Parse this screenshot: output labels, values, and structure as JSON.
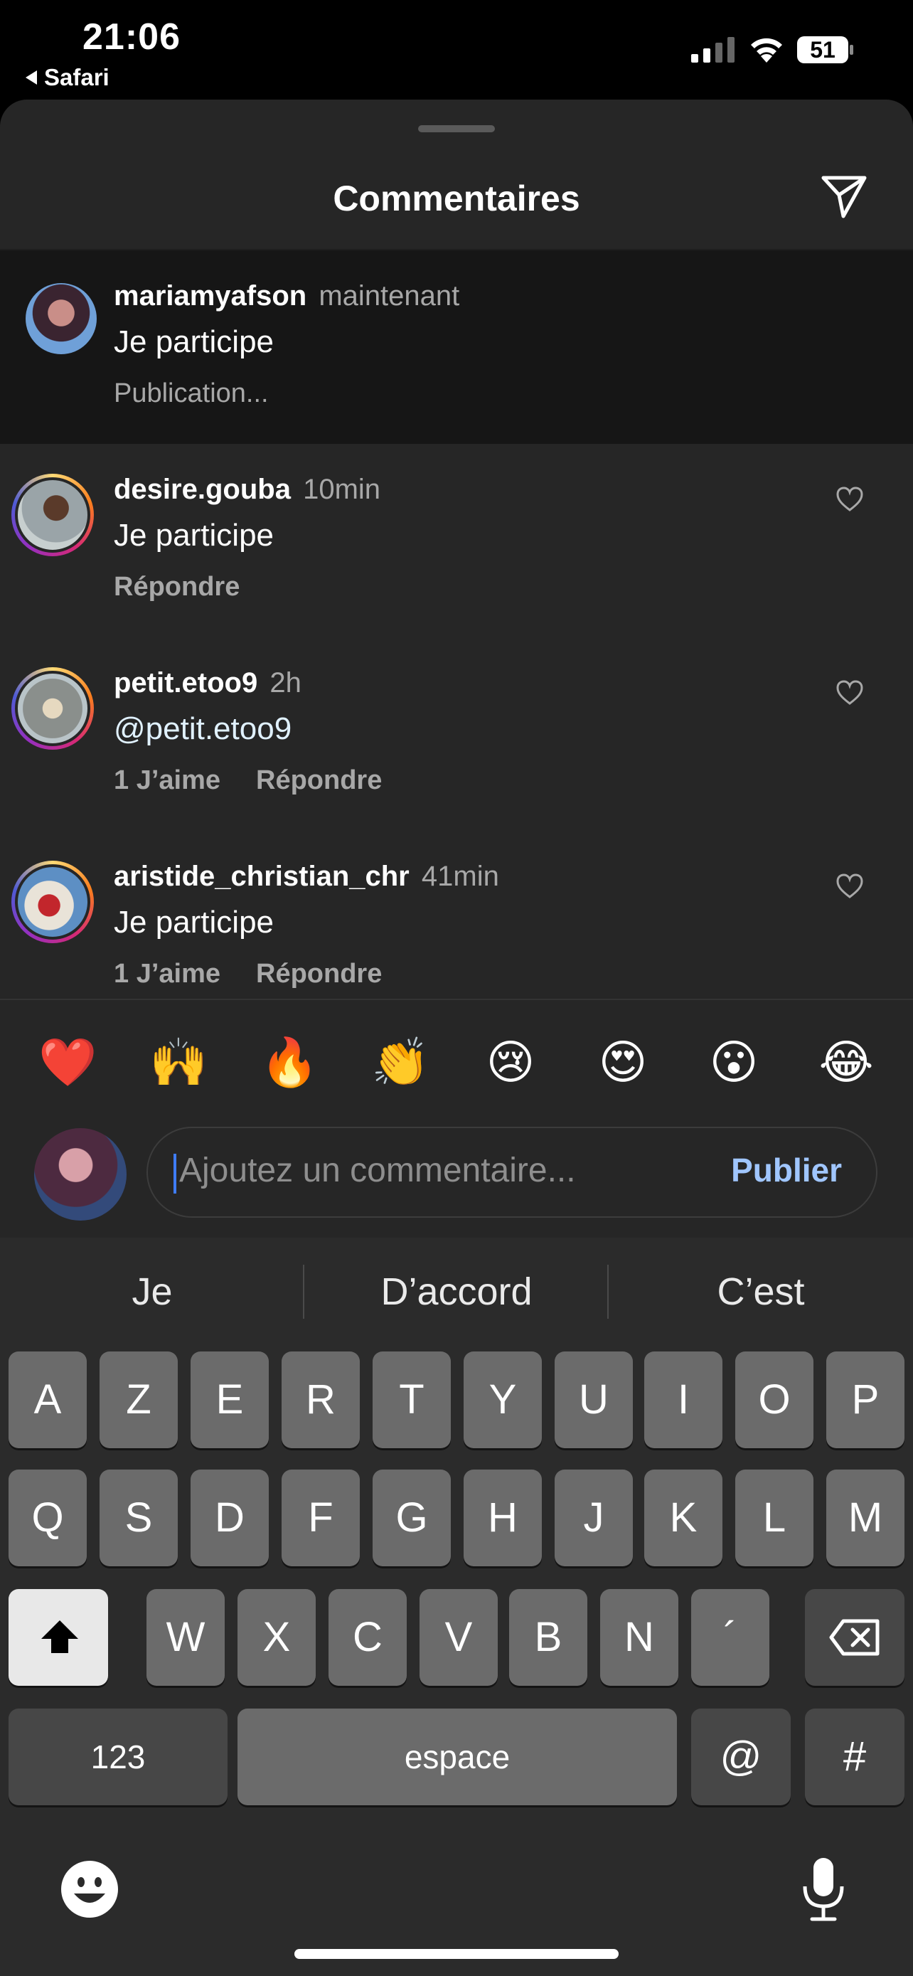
{
  "status_bar": {
    "time": "21:06",
    "back_app": "Safari",
    "battery": "51"
  },
  "sheet": {
    "title": "Commentaires"
  },
  "comments": [
    {
      "username": "mariamyafson",
      "time": "maintenant",
      "text": "Je participe",
      "status": "Publication..."
    },
    {
      "username": "desire.gouba",
      "time": "10min",
      "text": "Je participe",
      "reply": "Répondre"
    },
    {
      "username": "petit.etoo9",
      "time": "2h",
      "text": "@petit.etoo9",
      "likes": "1 J’aime",
      "reply": "Répondre"
    },
    {
      "username": "aristide_christian_chr",
      "time": "41min",
      "text": "Je participe",
      "likes": "1 J’aime",
      "reply": "Répondre"
    }
  ],
  "emoji_bar": [
    "❤️",
    "🙌",
    "🔥",
    "👏",
    "😢",
    "😍",
    "😮",
    "😂"
  ],
  "comment_input": {
    "placeholder": "Ajoutez un commentaire...",
    "publish": "Publier"
  },
  "keyboard": {
    "suggestions": [
      "Je",
      "D’accord",
      "C’est"
    ],
    "row1": [
      "A",
      "Z",
      "E",
      "R",
      "T",
      "Y",
      "U",
      "I",
      "O",
      "P"
    ],
    "row2": [
      "Q",
      "S",
      "D",
      "F",
      "G",
      "H",
      "J",
      "K",
      "L",
      "M"
    ],
    "row3": [
      "W",
      "X",
      "C",
      "V",
      "B",
      "N",
      "´"
    ],
    "numbers": "123",
    "space": "espace",
    "at": "@",
    "hash": "#"
  }
}
